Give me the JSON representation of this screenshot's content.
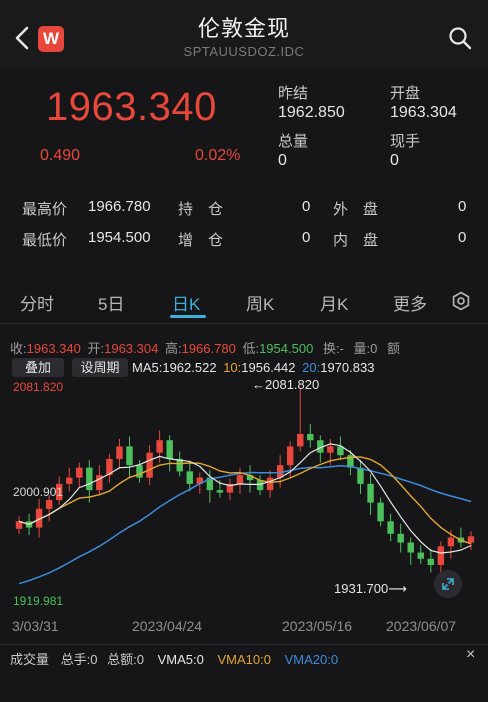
{
  "header": {
    "title": "伦敦金现",
    "code": "SPTAUUSDOZ.IDC",
    "logo_text": "W"
  },
  "quote": {
    "price": "1963.340",
    "change": "0.490",
    "change_pct": "0.02%",
    "prev_close_label": "昨结",
    "prev_close": "1962.850",
    "open_label": "开盘",
    "open": "1963.304",
    "total_vol_label": "总量",
    "total_vol": "0",
    "cur_vol_label": "现手",
    "cur_vol": "0"
  },
  "stats": {
    "high_label": "最高价",
    "high": "1966.780",
    "hold_label": "持　仓",
    "hold": "0",
    "outer_label": "外　盘",
    "outer": "0",
    "low_label": "最低价",
    "low": "1954.500",
    "add_label": "增　仓",
    "add": "0",
    "inner_label": "内　盘",
    "inner": "0"
  },
  "tabs": [
    "分时",
    "5日",
    "日K",
    "周K",
    "月K",
    "更多"
  ],
  "ohlc": {
    "close_label": "收:",
    "close": "1963.340",
    "open_label": "开:",
    "open": "1963.304",
    "high_label": "高:",
    "high": "1966.780",
    "low_label": "低:",
    "low": "1954.500",
    "turnover": "换:-",
    "volume": "量:0",
    "amount": "额"
  },
  "controls": {
    "overlay": "叠加",
    "period": "设周期"
  },
  "ma": {
    "ma5_label": "MA5:",
    "ma5": "1962.522",
    "ma10_label": "10:",
    "ma10": "1956.442",
    "ma20_label": "20:",
    "ma20": "1970.833"
  },
  "chart_labels": {
    "axis_high": "2081.820",
    "axis_mid": "2000.901",
    "axis_low": "1919.981",
    "peak_note": "←2081.820",
    "trough_note": "1931.700⟶"
  },
  "x_axis": [
    "3/03/31",
    "2023/04/24",
    "2023/05/16",
    "2023/06/07"
  ],
  "volume_row": {
    "title": "成交量",
    "hands_label": "总手:",
    "hands": "0",
    "amount_label": "总额:",
    "amount": "0",
    "vma5_label": "VMA5:",
    "vma5": "0",
    "vma10_label": "VMA10:",
    "vma10": "0",
    "vma20_label": "VMA20:",
    "vma20": "0",
    "close": "×"
  },
  "colors": {
    "up": "#e8483b",
    "down": "#4cc05a",
    "ma5": "#e6e6e9",
    "ma10": "#e2a62f",
    "ma20": "#3d8cdc",
    "accent": "#3cb0d8"
  },
  "icons": [
    "back-chevron-icon",
    "search-icon",
    "settings-gear-icon",
    "fullscreen-expand-icon",
    "close-icon"
  ]
}
